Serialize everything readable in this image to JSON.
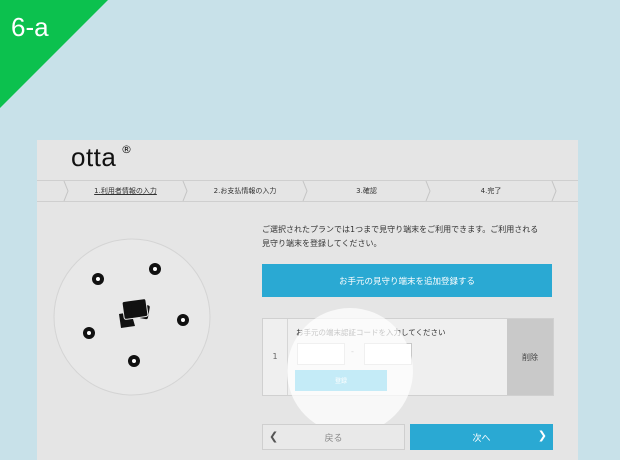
{
  "tag": {
    "label": "6-a",
    "color": "#0cc14e"
  },
  "app": {
    "logo": "otta",
    "logo_mark": "®"
  },
  "steps": [
    {
      "label": "1.利用者情報の入力",
      "active": true
    },
    {
      "label": "2.お支払情報の入力",
      "active": false
    },
    {
      "label": "3.確認",
      "active": false
    },
    {
      "label": "4.完了",
      "active": false
    }
  ],
  "description": {
    "line1": "ご選択されたプランでは1つまで見守り端末をご利用できます。ご利用される",
    "line2": "見守り端末を登録してください。"
  },
  "add_button": {
    "label": "お手元の見守り端末を追加登録する"
  },
  "device": {
    "row_number": "1",
    "code_label": "お手元の端末認証コードを入力してください",
    "code_separator": "-",
    "register_label": "登録",
    "delete_label": "削除"
  },
  "nav": {
    "back_label": "戻る",
    "next_label": "次へ",
    "back_icon": "chevron-left-icon",
    "next_icon": "chevron-right-icon"
  },
  "colors": {
    "accent": "#2aa9d3",
    "background": "#c8e1e9",
    "tag": "#0cc14e"
  }
}
